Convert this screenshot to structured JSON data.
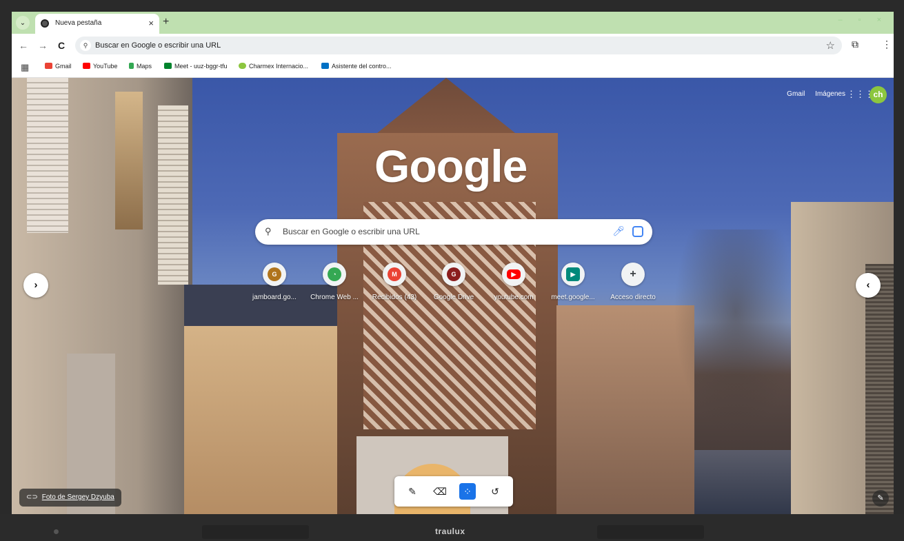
{
  "browser": {
    "tab": {
      "title": "Nueva pestaña",
      "close": "×"
    },
    "new_tab": "+",
    "tab_menu": "⌄",
    "window_controls": "– ▫ ×",
    "nav": {
      "back": "←",
      "forward": "→",
      "reload": "C"
    },
    "omnibox": {
      "placeholder": "Buscar en Google o escribir una URL"
    },
    "toolbar_icons": {
      "star": "☆",
      "extensions": "⧉",
      "menu": "⋮"
    },
    "bookmarks": [
      {
        "label": "Gmail",
        "color": "#ea4335"
      },
      {
        "label": "YouTube",
        "color": "#ff0000"
      },
      {
        "label": "Maps",
        "color": "#34a853"
      },
      {
        "label": "Meet - uuz-bggr-tfu",
        "color": "#00832d"
      },
      {
        "label": "Charmex Internacio...",
        "color": "#8cc63f"
      },
      {
        "label": "Asistente del contro...",
        "color": "#0071c5"
      }
    ]
  },
  "ntp": {
    "top_links": {
      "gmail": "Gmail",
      "images": "Imágenes"
    },
    "avatar_initials": "ch",
    "logo": "Google",
    "search_placeholder": "Buscar en Google o escribir una URL",
    "shortcuts": [
      {
        "label": "jamboard.go...",
        "glyph": "G",
        "color": "#b0741c"
      },
      {
        "label": "Chrome Web ...",
        "glyph": "◔",
        "color": "#34a853"
      },
      {
        "label": "Recibidos (43)",
        "glyph": "M",
        "color": "#ea4335"
      },
      {
        "label": "Google Drive",
        "glyph": "G",
        "color": "#8b1e1e"
      },
      {
        "label": "youtube.com",
        "glyph": "▶",
        "color": "#ff0000"
      },
      {
        "label": "meet.google...",
        "glyph": "▶",
        "color": "#00897b"
      },
      {
        "label": "Acceso directo",
        "glyph": "+",
        "color": "#5f6368"
      }
    ],
    "nav_next": "›",
    "nav_prev": "‹",
    "photo_credit": "Foto de Sergey Dzyuba",
    "photo_credit_icon": "⊂⊃",
    "customize_icon": "✎"
  },
  "annotation_tools": {
    "pen": "✎",
    "eraser": "⌫",
    "select": "⁘",
    "undo": "↺"
  },
  "device": {
    "brand": "traulux"
  }
}
